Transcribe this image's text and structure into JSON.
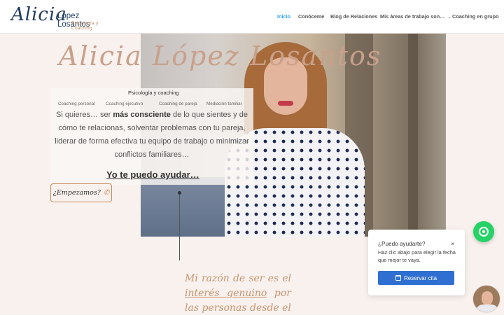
{
  "header": {
    "logo_script": "Alicia",
    "logo_name": "López Losantos",
    "logo_sub": "Psicología y Coaching",
    "nav": [
      {
        "label": "Inicio",
        "active": true
      },
      {
        "label": "Conóceme",
        "active": false
      },
      {
        "label": "Blog de Relaciones",
        "active": false
      },
      {
        "label": "Mis áreas de trabajo son…",
        "active": false,
        "dropdown": true
      },
      {
        "label": "Coaching en grupo",
        "active": false
      }
    ]
  },
  "hero": {
    "signature": "Alicia López Losantos",
    "panel_title": "Psicología y coaching",
    "tags": [
      "Coaching personal",
      "Coaching ejecutivo",
      "Coaching de pareja",
      "Mediación familiar"
    ],
    "intro_before": "Si quieres… ser ",
    "intro_bold": "más consciente",
    "intro_after": " de lo que sientes y de cómo te relacionas, solventar problemas con tu pareja, liderar de forma efectiva tu equipo de trabajo o minimizar conflictos familiares…",
    "help": "Yo te puedo ayudar…",
    "cta": "¿Empezamos?",
    "cta_icon": "phone-icon"
  },
  "mission": {
    "part1": "Mi razón de ser es el ",
    "underlined": "interés genuino",
    "part2": " por las personas desde el"
  },
  "chat": {
    "title": "¿Puedo ayudarte?",
    "close": "×",
    "body": "Haz clic abajo para elegir la fecha que mejor te vaya.",
    "button": "Reservar cita",
    "button_icon": "calendar-icon",
    "button_color": "#2f6fd1",
    "whatsapp_color": "#25d366"
  },
  "colors": {
    "accent": "#c68c60",
    "nav_active": "#2ea3f2",
    "background": "#f8f1ee"
  }
}
